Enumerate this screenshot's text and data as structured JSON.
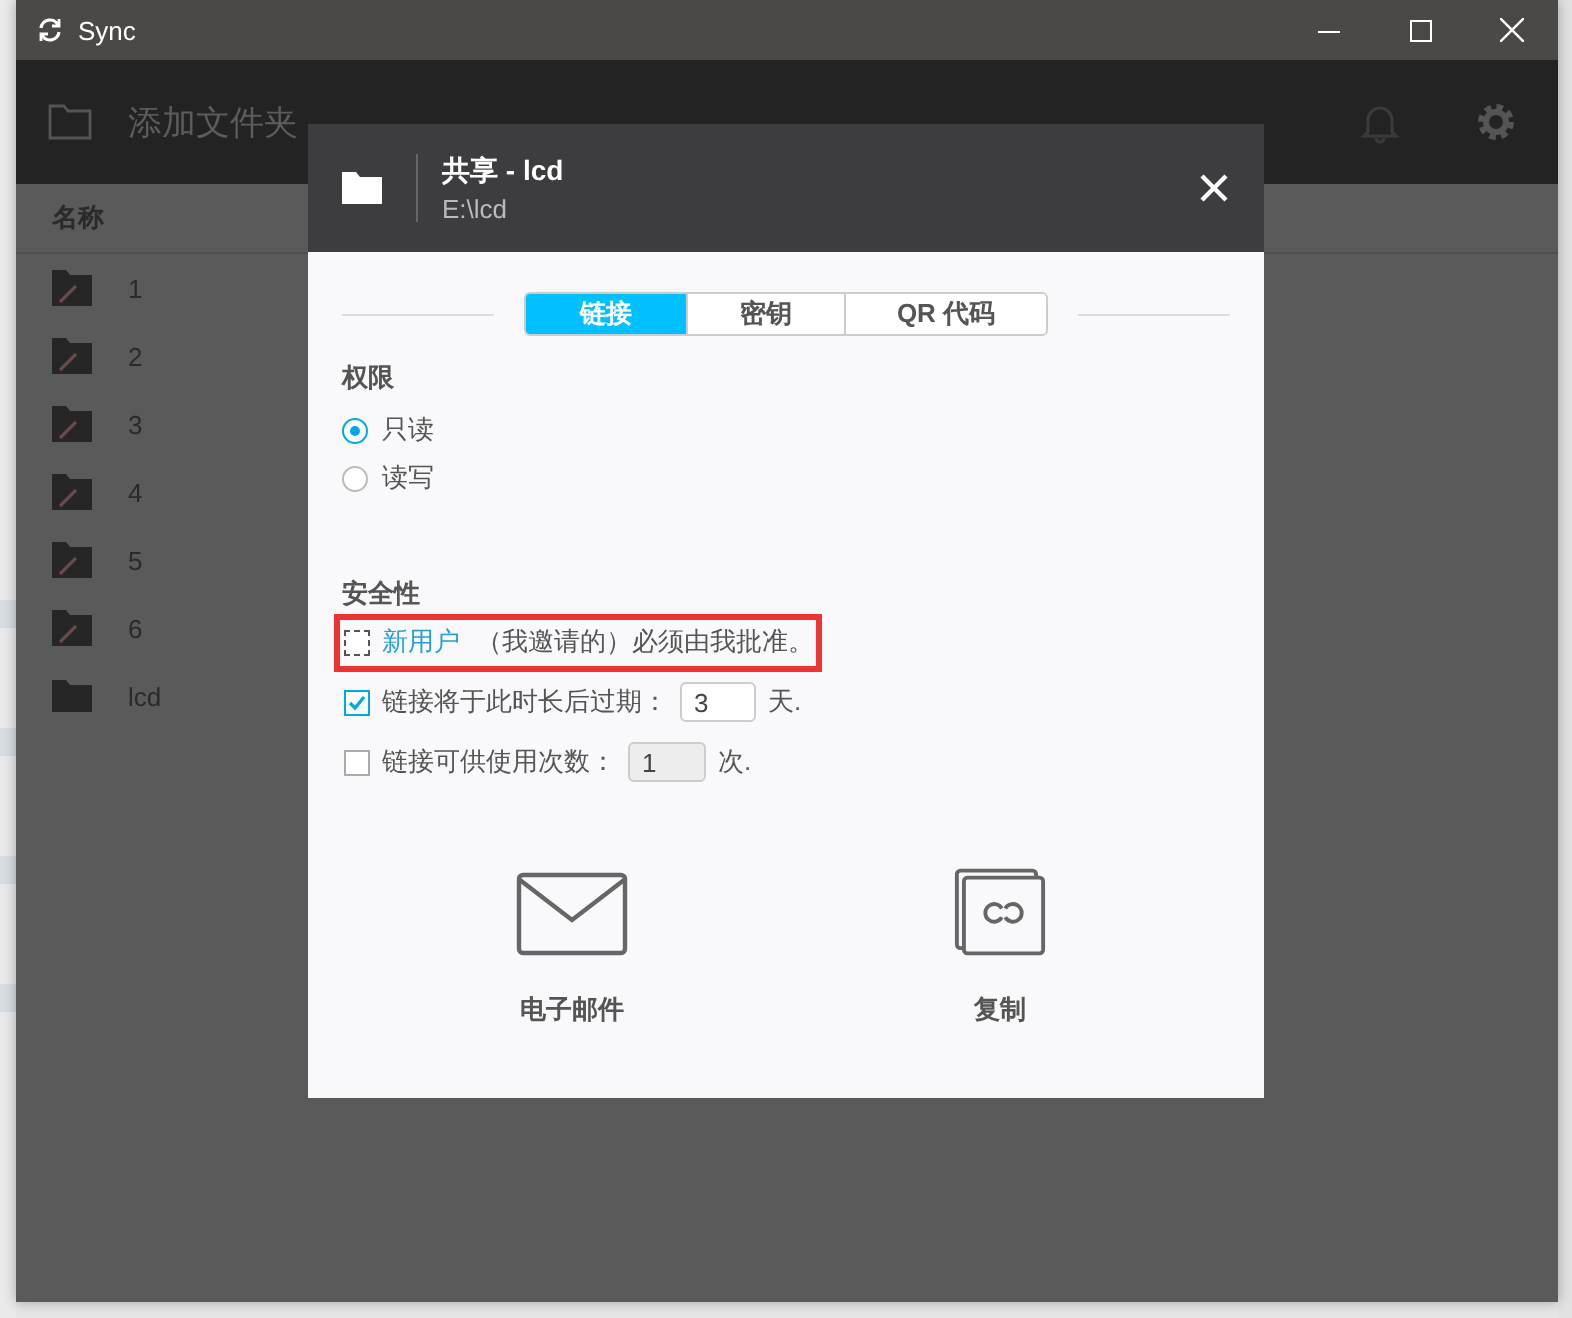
{
  "window": {
    "title": "Sync"
  },
  "toolbar": {
    "add_folder": "添加文件夹"
  },
  "list": {
    "column": "名称",
    "items": [
      {
        "name": "1",
        "kind": "readonly"
      },
      {
        "name": "2",
        "kind": "readonly"
      },
      {
        "name": "3",
        "kind": "readonly"
      },
      {
        "name": "4",
        "kind": "readonly"
      },
      {
        "name": "5",
        "kind": "readonly"
      },
      {
        "name": "6",
        "kind": "readonly"
      },
      {
        "name": "lcd",
        "kind": "plain"
      }
    ]
  },
  "dialog": {
    "title": "共享 - lcd",
    "path": "E:\\lcd",
    "tabs": [
      {
        "label": "链接",
        "selected": true
      },
      {
        "label": "密钥",
        "selected": false
      },
      {
        "label": "QR 代码",
        "selected": false
      }
    ],
    "permissions": {
      "heading": "权限",
      "options": [
        {
          "label": "只读",
          "selected": true
        },
        {
          "label": "读写",
          "selected": false
        }
      ]
    },
    "security": {
      "heading": "安全性",
      "options": [
        {
          "kind": "approval",
          "checked": false,
          "link": "新用户",
          "label": "（我邀请的）必须由我批准。",
          "highlighted": true
        },
        {
          "kind": "expiry",
          "checked": true,
          "label": "链接将于此时长后过期：",
          "value": "3",
          "disabled": false,
          "unit": "天.",
          "highlighted": false
        },
        {
          "kind": "uses",
          "checked": false,
          "label": "链接可供使用次数：",
          "value": "1",
          "disabled": true,
          "unit": "次.",
          "highlighted": false
        }
      ]
    },
    "actions": [
      {
        "kind": "email",
        "label": "电子邮件"
      },
      {
        "kind": "copy",
        "label": "复制"
      }
    ]
  }
}
